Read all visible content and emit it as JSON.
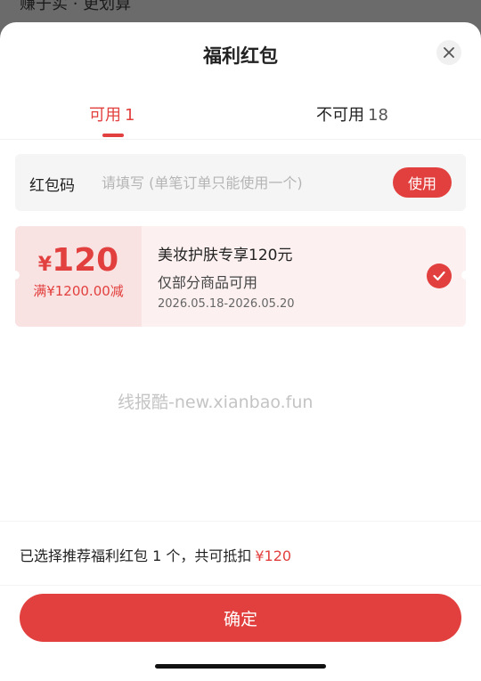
{
  "backdrop": {
    "text": "赚子实 · 更划算"
  },
  "sheet": {
    "title": "福利红包"
  },
  "tabs": [
    {
      "label": "可用",
      "count": "1",
      "active": true
    },
    {
      "label": "不可用",
      "count": "18",
      "active": false
    }
  ],
  "code_input": {
    "label": "红包码",
    "placeholder": "请填写 (单笔订单只能使用一个)",
    "value": "",
    "button_label": "使用"
  },
  "coupon": {
    "currency": "¥",
    "amount": "120",
    "condition": "满¥1200.00减",
    "name": "美妆护肤专享120元",
    "scope": "仅部分商品可用",
    "validity": "2026.05.18-2026.05.20",
    "selected": true
  },
  "watermark": "线报酷-new.xianbao.fun",
  "summary": {
    "text": "已选择推荐福利红包 1 个，共可抵扣",
    "amount": "¥120"
  },
  "confirm_label": "确定",
  "colors": {
    "accent": "#e2403e",
    "coupon_bg": "#fcf0f0",
    "coupon_left_bg": "#f9e2e2"
  },
  "icons": {
    "close": "close-icon",
    "check": "check-icon"
  }
}
